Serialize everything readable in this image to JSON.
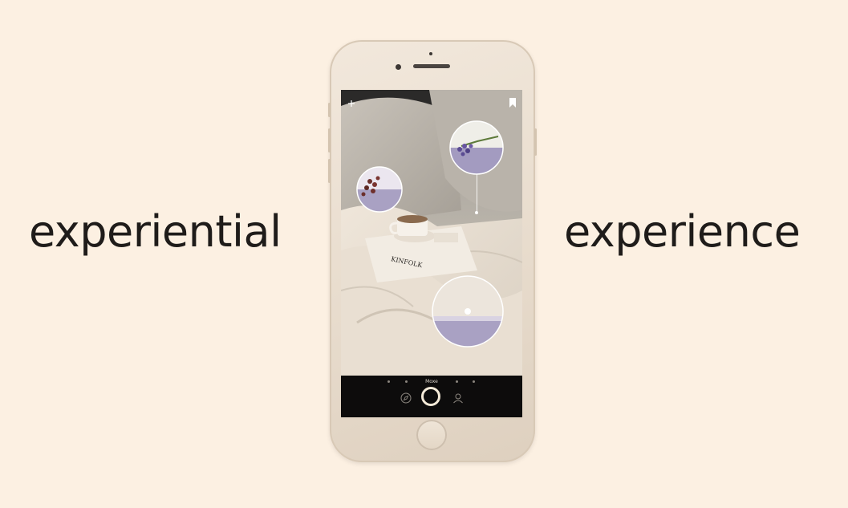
{
  "headline": {
    "left_word": "experiential",
    "right_word": "experience"
  },
  "phone": {
    "tabbar": {
      "active_label": "Moxe",
      "icons": {
        "left": "compass-icon",
        "center": "capture-button",
        "right": "profile-icon"
      }
    },
    "top_bar": {
      "left_icon": "plus-icon",
      "right_icon": "bookmark-icon"
    },
    "photo_scene": {
      "book_text": "KINFOLK"
    }
  },
  "colors": {
    "background": "#fcf0e2",
    "text": "#1f1c1a",
    "phone_body": "#ede3d6",
    "tabbar": "#0d0c0c",
    "accent_lavender": "#a9a1c3"
  }
}
